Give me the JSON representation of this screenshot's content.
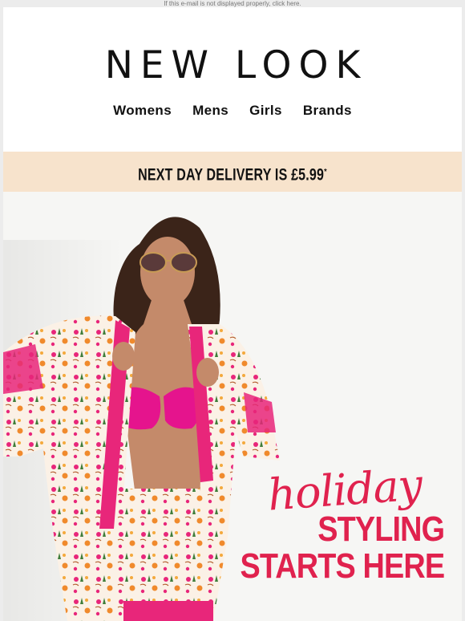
{
  "preheader": {
    "text": "If this e-mail is not displayed properly, click here."
  },
  "brand": {
    "logo_text": "NEW LOOK"
  },
  "nav": {
    "items": [
      {
        "label": "Womens"
      },
      {
        "label": "Mens"
      },
      {
        "label": "Girls"
      },
      {
        "label": "Brands"
      }
    ]
  },
  "banner": {
    "text": "NEXT DAY DELIVERY IS £5.99",
    "footnote_mark": "*"
  },
  "hero": {
    "script_text": "holiday",
    "headline_line1": "STYLING",
    "headline_line2": "STARTS HERE",
    "image_alt": "Model in pink floral print shirt, shorts and pink bikini top with sunglasses"
  },
  "colors": {
    "accent": "#e0224e",
    "banner_bg": "#f7e3cc",
    "print_pink": "#e8267a"
  }
}
